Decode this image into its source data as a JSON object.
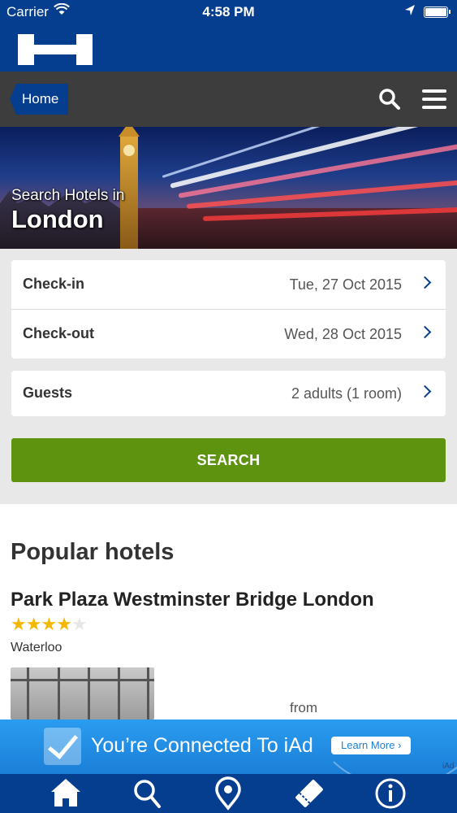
{
  "status_bar": {
    "carrier": "Carrier",
    "time": "4:58 PM",
    "icons": [
      "wifi-icon",
      "location-arrow-icon",
      "battery-icon"
    ]
  },
  "brand": {
    "logo_icon": "hotels-h-logo"
  },
  "nav": {
    "home_label": "Home",
    "icons": [
      "search-icon",
      "menu-icon"
    ]
  },
  "hero": {
    "subtitle": "Search Hotels in",
    "city": "London"
  },
  "form": {
    "checkin": {
      "label": "Check-in",
      "value": "Tue, 27 Oct 2015"
    },
    "checkout": {
      "label": "Check-out",
      "value": "Wed, 28 Oct 2015"
    },
    "guests": {
      "label": "Guests",
      "value": "2 adults (1 room)"
    },
    "search_label": "SEARCH"
  },
  "popular": {
    "title": "Popular hotels",
    "hotels": [
      {
        "name": "Park Plaza Westminster Bridge London",
        "stars": 4,
        "stars_max": 5,
        "district": "Waterloo",
        "price_prefix": "from"
      }
    ]
  },
  "ad": {
    "text": "You’re Connected To iAd",
    "button": "Learn More",
    "tag": "iAd"
  },
  "tab_bar": {
    "items": [
      "home-icon",
      "search-icon",
      "map-pin-icon",
      "ticket-icon",
      "info-icon"
    ]
  },
  "colors": {
    "brand_blue": "#063e8f",
    "nav_gray": "#3d3d3d",
    "search_green": "#5e9310",
    "star_yellow": "#f5b800",
    "ad_blue": "#1b7fd8"
  }
}
